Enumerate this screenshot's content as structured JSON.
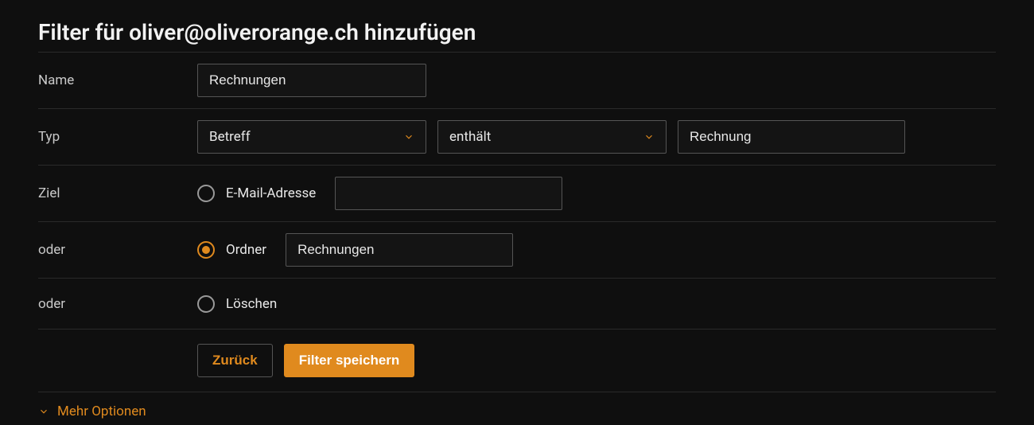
{
  "header": {
    "title": "Filter für oliver@oliverorange.ch hinzufügen"
  },
  "rows": {
    "name": {
      "label": "Name",
      "value": "Rechnungen"
    },
    "type": {
      "label": "Typ",
      "field_select": "Betreff",
      "match_select": "enthält",
      "value": "Rechnung"
    },
    "targetEmail": {
      "label": "Ziel",
      "radio_label": "E-Mail-Adresse",
      "checked": false,
      "value": ""
    },
    "targetFolder": {
      "label": "oder",
      "radio_label": "Ordner",
      "checked": true,
      "value": "Rechnungen"
    },
    "targetDelete": {
      "label": "oder",
      "radio_label": "Löschen",
      "checked": false
    }
  },
  "buttons": {
    "back": "Zurück",
    "save": "Filter speichern"
  },
  "more_options": "Mehr Optionen",
  "colors": {
    "accent": "#e08a1e"
  }
}
